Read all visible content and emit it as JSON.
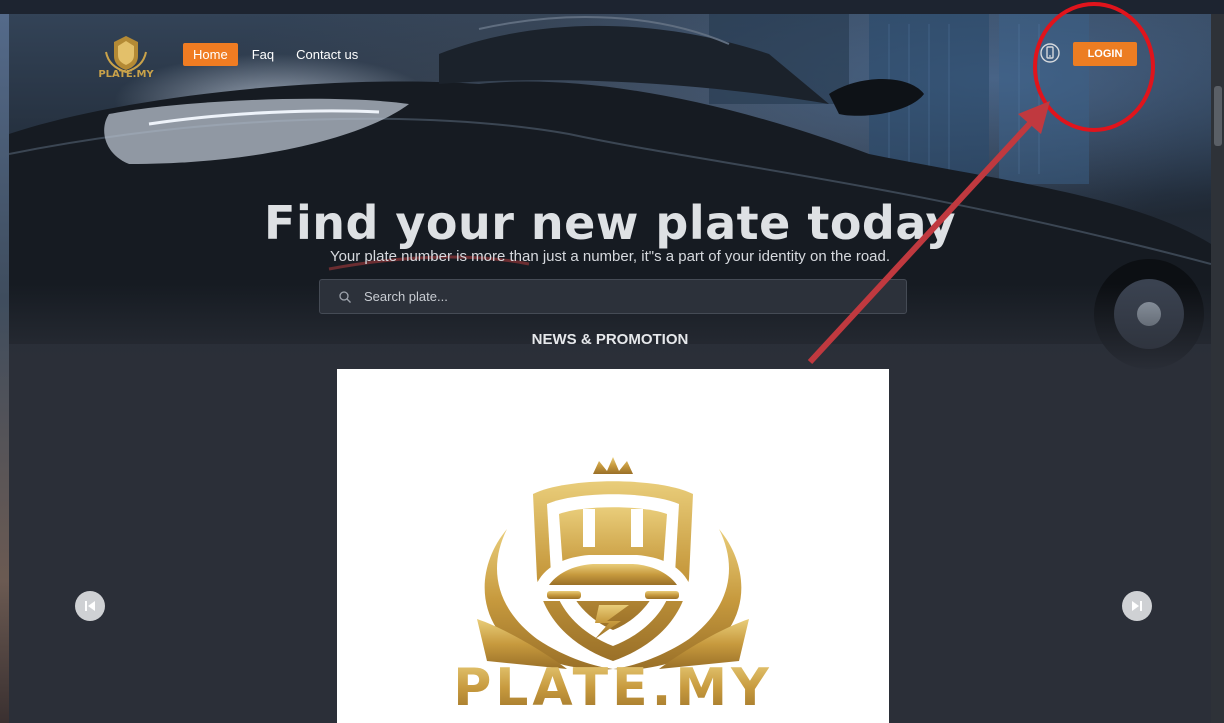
{
  "nav": {
    "logo_text": "PLATE.MY",
    "items": [
      {
        "label": "Home",
        "active": true
      },
      {
        "label": "Faq",
        "active": false
      },
      {
        "label": "Contact us",
        "active": false
      }
    ],
    "phone_icon": "mobile-phone-icon",
    "login_label": "LOGIN"
  },
  "hero": {
    "title": "Find your new plate today",
    "subtitle": "Your plate number is more than just a number, it\"s a part of your identity on the road."
  },
  "search": {
    "icon": "search-icon",
    "placeholder": "Search plate..."
  },
  "news": {
    "heading": "NEWS & PROMOTION",
    "slide_logo_text": "PLATE.MY",
    "prev_icon": "skip-previous-icon",
    "next_icon": "skip-next-icon"
  },
  "colors": {
    "accent": "#f07c22",
    "background": "#2b2f38",
    "gold": "#c9a24a",
    "annotation": "#e0141c"
  }
}
